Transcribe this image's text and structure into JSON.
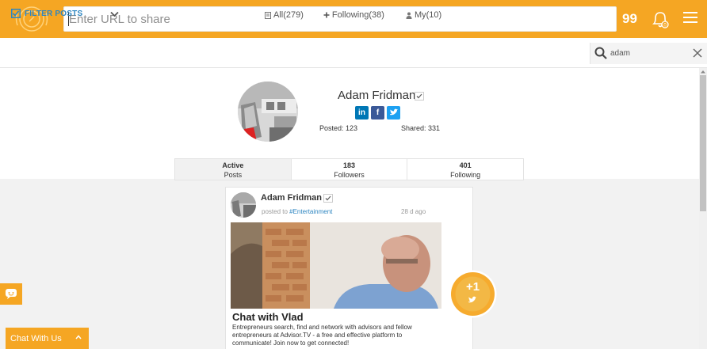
{
  "colors": {
    "accent": "#f5a623",
    "link": "#2e86c1",
    "linkedin": "#0077b5",
    "facebook": "#3b5998",
    "twitter": "#1da1f2"
  },
  "header": {
    "url_placeholder": "Enter URL to share",
    "counter": "99",
    "icons": [
      "logo-icon",
      "bell-icon",
      "menu-icon"
    ]
  },
  "filterbar": {
    "filter_label": "FILTER POSTS",
    "tabs": [
      {
        "label": "All(279)",
        "icon": "document-icon"
      },
      {
        "label": "Following(38)",
        "icon": "plus-icon"
      },
      {
        "label": "My(10)",
        "icon": "person-icon"
      }
    ],
    "search_value": "adam"
  },
  "profile": {
    "name": "Adam Fridman",
    "posted": "Posted: 123",
    "shared": "Shared: 331",
    "social": [
      {
        "label": "in",
        "icon": "linkedin-icon"
      },
      {
        "label": "f",
        "icon": "facebook-icon"
      },
      {
        "label": "t",
        "icon": "twitter-icon"
      }
    ],
    "stats": [
      {
        "value": "Active",
        "label": "Posts"
      },
      {
        "value": "183",
        "label": "Followers"
      },
      {
        "value": "401",
        "label": "Following"
      }
    ]
  },
  "post": {
    "author": "Adam Fridman",
    "posted_to_prefix": "posted to ",
    "category": "#Entertainment",
    "time": "28 d ago",
    "title": "Chat with Vlad",
    "description": "Entrepreneurs search, find and network with advisors and fellow entrepreneurs at Advisor.TV - a free and effective platform to communicate! Join now to get connected!",
    "plus_label": "+1"
  },
  "chat": {
    "label": "Chat With Us"
  }
}
